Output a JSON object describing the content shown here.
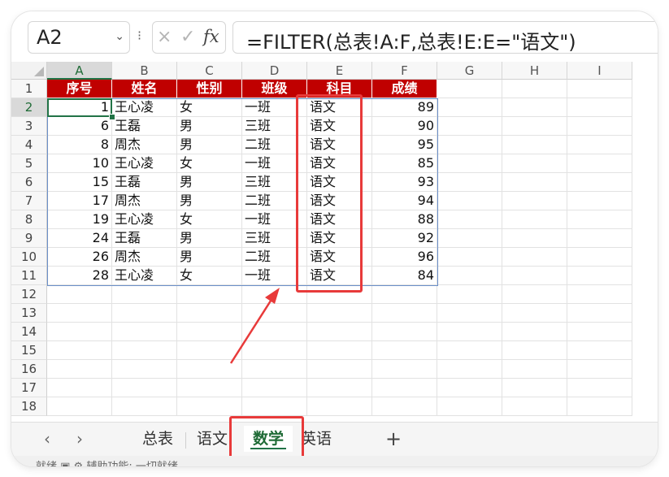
{
  "namebox": {
    "value": "A2",
    "dropdown_icon": "chevron-down-icon"
  },
  "formula_bar": {
    "cancel_icon": "×",
    "confirm_icon": "✓",
    "fx_label": "fx",
    "formula": "=FILTER(总表!A:F,总表!E:E=\"语文\")"
  },
  "columns": [
    "A",
    "B",
    "C",
    "D",
    "E",
    "F",
    "G",
    "H",
    "I"
  ],
  "rows": [
    "1",
    "2",
    "3",
    "4",
    "5",
    "6",
    "7",
    "8",
    "9",
    "10",
    "11",
    "12",
    "13",
    "14",
    "15",
    "16",
    "17",
    "18"
  ],
  "table": {
    "headers": [
      "序号",
      "姓名",
      "性别",
      "班级",
      "科目",
      "成绩"
    ],
    "data": [
      [
        "1",
        "王心凌",
        "女",
        "一班",
        "语文",
        "89"
      ],
      [
        "6",
        "王磊",
        "男",
        "三班",
        "语文",
        "90"
      ],
      [
        "8",
        "周杰",
        "男",
        "二班",
        "语文",
        "95"
      ],
      [
        "10",
        "王心凌",
        "女",
        "一班",
        "语文",
        "85"
      ],
      [
        "15",
        "王磊",
        "男",
        "三班",
        "语文",
        "93"
      ],
      [
        "17",
        "周杰",
        "男",
        "二班",
        "语文",
        "94"
      ],
      [
        "19",
        "王心凌",
        "女",
        "一班",
        "语文",
        "88"
      ],
      [
        "24",
        "王磊",
        "男",
        "三班",
        "语文",
        "92"
      ],
      [
        "26",
        "周杰",
        "男",
        "二班",
        "语文",
        "96"
      ],
      [
        "28",
        "王心凌",
        "女",
        "一班",
        "语文",
        "84"
      ]
    ]
  },
  "sheet_tabs": {
    "prev_icon": "‹",
    "next_icon": "›",
    "tabs": [
      "总表",
      "语文",
      "数学",
      "英语"
    ],
    "active_index": 2,
    "add_icon": "+"
  },
  "status_bar": {
    "text": "就绪    ▣    ⚙ 辅助功能: 一切就绪"
  },
  "colors": {
    "header_fill": "#c00000",
    "header_text": "#ffffff",
    "highlight": "#e83a3a",
    "excel_green": "#217346"
  }
}
